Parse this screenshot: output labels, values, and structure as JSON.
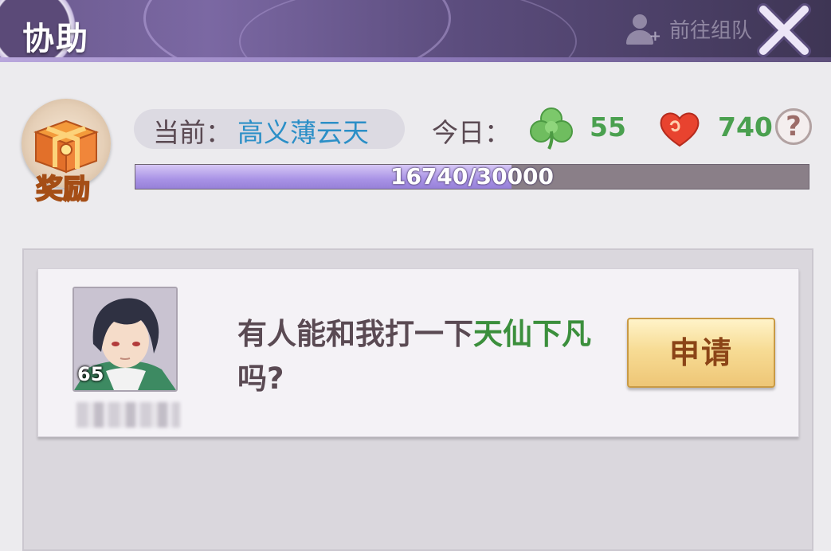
{
  "header": {
    "title": "协助",
    "goto_team_label": "前往组队",
    "icons": {
      "close": "close-x-icon",
      "team": "add-person-icon"
    }
  },
  "reward": {
    "label": "奖励",
    "icon": "treasure-chest-icon"
  },
  "status": {
    "current_label": "当前：",
    "current_value": "高义薄云天",
    "today_label": "今日：",
    "clover_value": "55",
    "heart_value": "740",
    "help_label": "?",
    "icons": {
      "clover": "clover-icon",
      "heart": "heart-icon"
    }
  },
  "progress": {
    "current": 16740,
    "max": 30000,
    "text": "16740/30000"
  },
  "requests": [
    {
      "level": "65",
      "message_prefix": "有人能和我打一下",
      "message_highlight": "天仙下凡",
      "message_suffix": "吗?",
      "apply_label": "申请"
    }
  ],
  "colors": {
    "header_purple": "#6b5a8e",
    "accent_blue": "#2b8fc7",
    "value_green": "#4aa04f",
    "progress_fill": "#a993e6",
    "button_gold": "#f7dc95"
  }
}
